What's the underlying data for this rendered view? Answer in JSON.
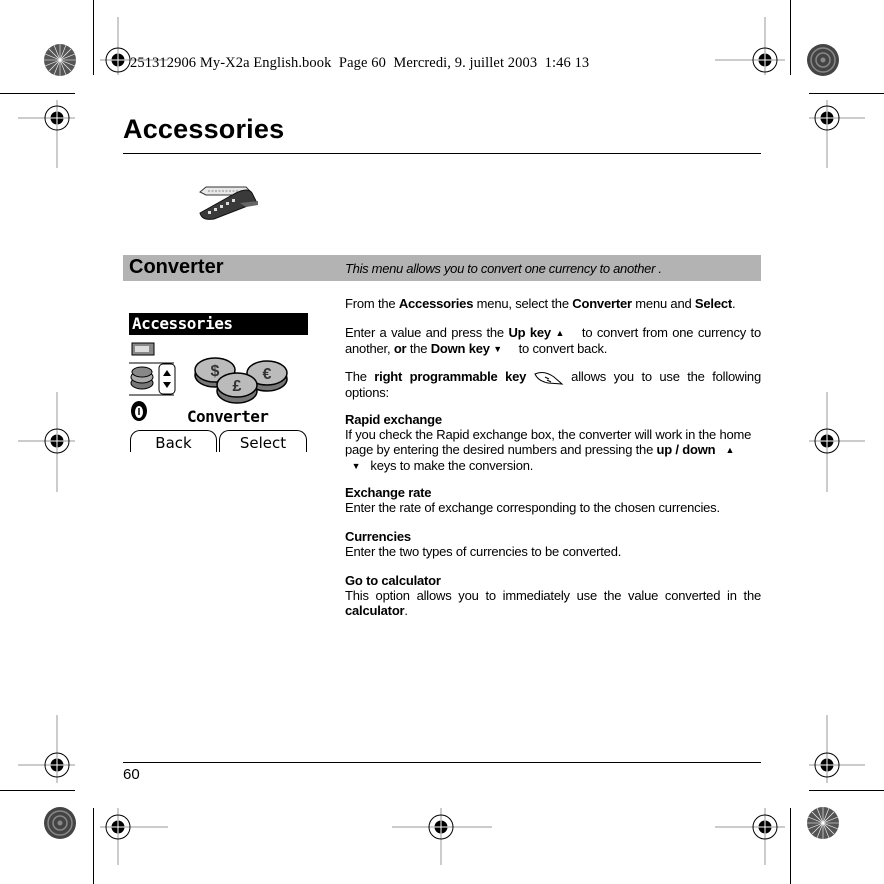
{
  "print_header": {
    "meta_text": "251312906 My-X2a English.book  Page 60  Mercredi, 9. juillet 2003  1:46 13"
  },
  "page": {
    "title": "Accessories",
    "number": "60",
    "accessories_icon": "stapler-knife-icon"
  },
  "section": {
    "name": "Converter",
    "description": "This menu allows you to convert one currency to another .",
    "bar_color": "#b3b3b3"
  },
  "phone_screen": {
    "title": "Accessories",
    "selected_item": "Converter",
    "icons": [
      "calculator-icon",
      "coins-stack-icon",
      "up-down-arrows-icon",
      "stopwatch-icon",
      "currency-coins-icon"
    ],
    "coin_symbols": [
      "$",
      "£",
      "€"
    ],
    "softkeys": {
      "left": "Back",
      "right": "Select"
    }
  },
  "content": {
    "intro": {
      "p1_a": "From the ",
      "p1_b": "Accessories",
      "p1_c": " menu, select the ",
      "p1_d": "Converter",
      "p1_e": " menu and ",
      "p1_f": "Select",
      "p1_g": "."
    },
    "keys": {
      "a": "Enter a value and press the ",
      "up_key": "Up key",
      "b": " to convert from one currency to another, ",
      "or": "or",
      "c": " the ",
      "down_key": "Down key",
      "d": " to convert back.",
      "up_icon": "▲",
      "down_icon": "▼"
    },
    "right_key": {
      "a": "The ",
      "bold": "right programmable key",
      "b": " allows you to use the following options:"
    },
    "options": [
      {
        "heading": "Rapid exchange",
        "text_a": "If you check the Rapid exchange box, the converter will work in the home page by entering the desired numbers and pressing the ",
        "bold": "up / down",
        "text_b": " keys to make the conversion."
      },
      {
        "heading": "Exchange rate",
        "text": "Enter the rate of exchange corresponding to the chosen currencies."
      },
      {
        "heading": "Currencies",
        "text": "Enter the two types of currencies to be converted."
      },
      {
        "heading": "Go to calculator",
        "text_a": "This option allows you to immediately use the value converted in the ",
        "bold": "calculator",
        "text_b": "."
      }
    ]
  }
}
